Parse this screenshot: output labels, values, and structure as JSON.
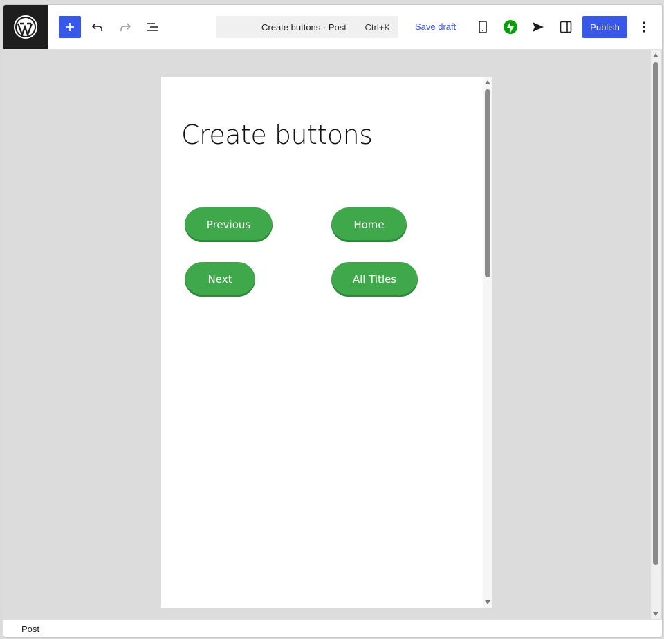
{
  "header": {
    "command_title": "Create buttons · Post",
    "command_shortcut": "Ctrl+K",
    "save_draft": "Save draft",
    "publish": "Publish"
  },
  "icons": {
    "logo": "wordpress-logo-icon",
    "inserter": "plus-icon",
    "undo": "undo-icon",
    "redo": "redo-icon",
    "list_view": "list-view-icon",
    "preview": "mobile-preview-icon",
    "jetpack": "jetpack-icon",
    "send": "send-icon",
    "sidebar": "sidebar-toggle-icon",
    "options": "vertical-ellipsis-icon"
  },
  "colors": {
    "accent": "#3858e9",
    "button_green": "#3ea84a",
    "jetpack_green": "#069e08"
  },
  "post": {
    "title": "Create buttons",
    "buttons": [
      {
        "label": "Previous"
      },
      {
        "label": "Home"
      },
      {
        "label": "Next"
      },
      {
        "label": "All Titles"
      }
    ]
  },
  "footer": {
    "breadcrumb": "Post"
  }
}
